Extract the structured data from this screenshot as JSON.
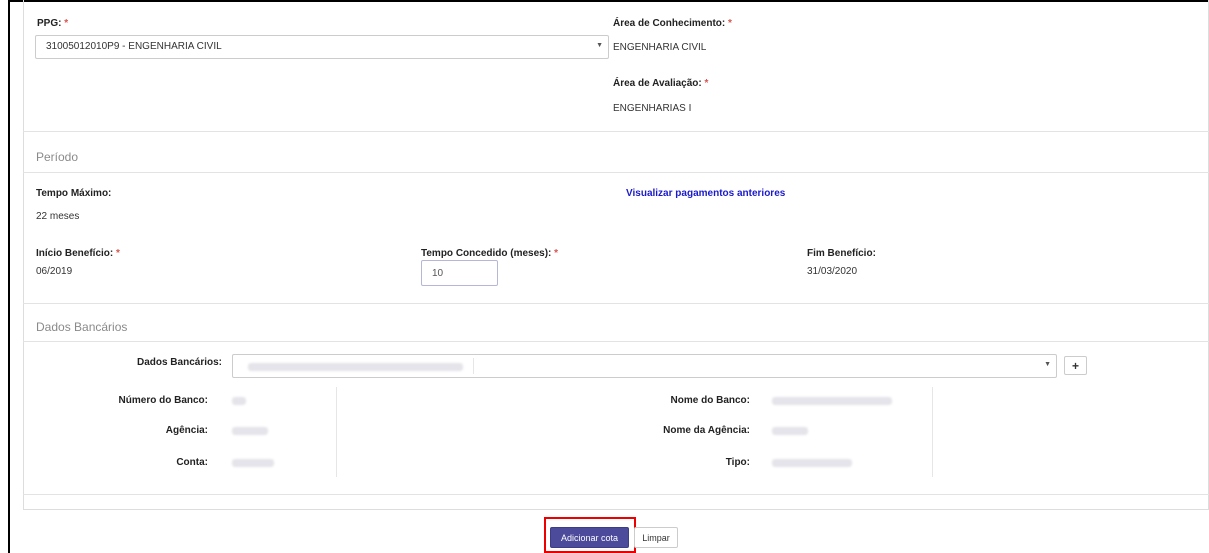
{
  "ppg": {
    "label": "PPG:",
    "required_mark": "*",
    "selected": "31005012010P9 - ENGENHARIA CIVIL",
    "arrow": "▼"
  },
  "area_conhecimento": {
    "label": "Área de Conhecimento:",
    "required_mark": "*",
    "value": "ENGENHARIA CIVIL"
  },
  "area_avaliacao": {
    "label": "Área de Avaliação:",
    "required_mark": "*",
    "value": "ENGENHARIAS I"
  },
  "periodo": {
    "section_title": "Período",
    "tempo_maximo_label": "Tempo Máximo:",
    "tempo_maximo_value": "22 meses",
    "link_pagamentos": "Visualizar pagamentos anteriores",
    "inicio_label": "Início Benefício:",
    "inicio_required": "*",
    "inicio_value": "06/2019",
    "tempo_concedido_label": "Tempo Concedido (meses):",
    "tempo_concedido_required": "*",
    "tempo_concedido_value": "10",
    "fim_label": "Fim Benefício:",
    "fim_value": "31/03/2020"
  },
  "dados_bancarios": {
    "section_title": "Dados Bancários",
    "select_label": "Dados Bancários:",
    "add_button": "+",
    "arrow": "▼",
    "numero_banco_label": "Número do Banco:",
    "agencia_label": "Agência:",
    "conta_label": "Conta:",
    "nome_banco_label": "Nome do Banco:",
    "nome_agencia_label": "Nome da Agência:",
    "tipo_label": "Tipo:"
  },
  "actions": {
    "adicionar": "Adicionar cota",
    "limpar": "Limpar"
  }
}
